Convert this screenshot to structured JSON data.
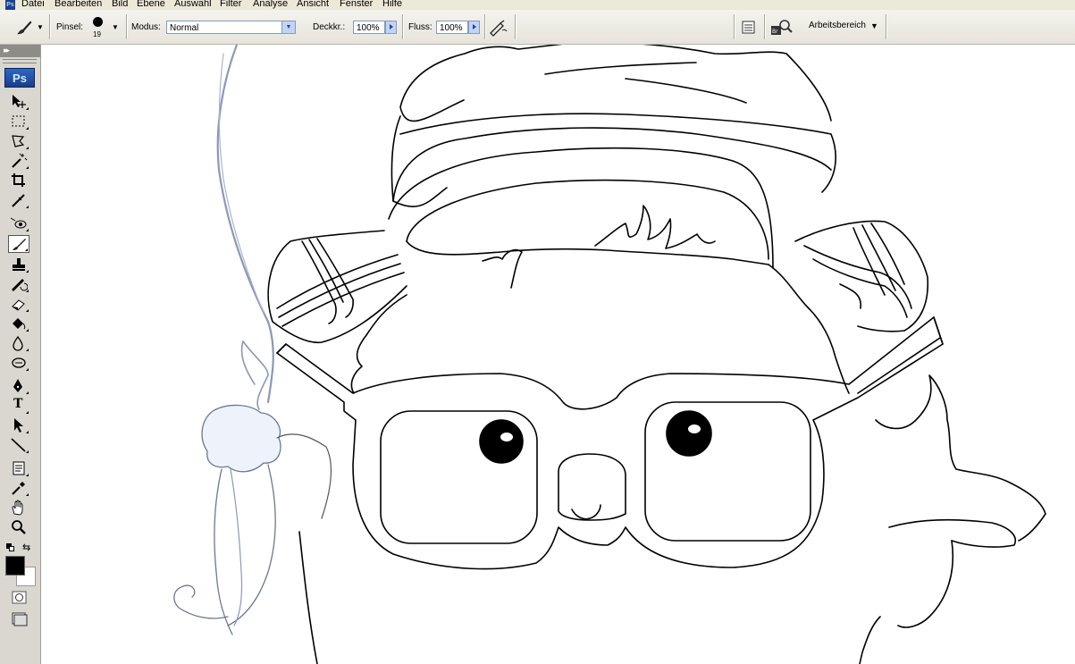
{
  "menu": {
    "items": [
      "Datei",
      "Bearbeiten",
      "Bild",
      "Ebene",
      "Auswahl",
      "Filter",
      "Analyse",
      "Ansicht",
      "Fenster",
      "Hilfe"
    ]
  },
  "options": {
    "brush_label": "Pinsel:",
    "brush_size": "19",
    "mode_label": "Modus:",
    "mode_value": "Normal",
    "opacity_label": "Deckkr.:",
    "opacity_value": "100%",
    "flow_label": "Fluss:",
    "flow_value": "100%",
    "workspace_label": "Arbeitsbereich"
  },
  "toolbox": {
    "logo": "Ps",
    "text_tool_glyph": "T",
    "active_tool": "brush-tool",
    "tools": [
      "move-tool-icon",
      "marquee-tool-icon",
      "lasso-tool-icon",
      "magic-wand-tool-icon",
      "crop-tool-icon",
      "slice-tool-icon",
      "healing-brush-tool-icon",
      "brush-tool-icon",
      "clone-stamp-tool-icon",
      "history-brush-tool-icon",
      "eraser-tool-icon",
      "paint-bucket-tool-icon",
      "blur-tool-icon",
      "dodge-tool-icon",
      "pen-tool-icon",
      "text-tool-icon",
      "path-selection-tool-icon",
      "line-tool-icon",
      "notes-tool-icon",
      "eyedropper-tool-icon",
      "hand-tool-icon",
      "zoom-tool-icon"
    ],
    "foreground_color": "#000000",
    "background_color": "#ffffff"
  },
  "colors": {
    "menubar_bg": "#ECE9D8",
    "toolbox_bg": "#D9D7CF",
    "accent": "#1A3E8C"
  }
}
